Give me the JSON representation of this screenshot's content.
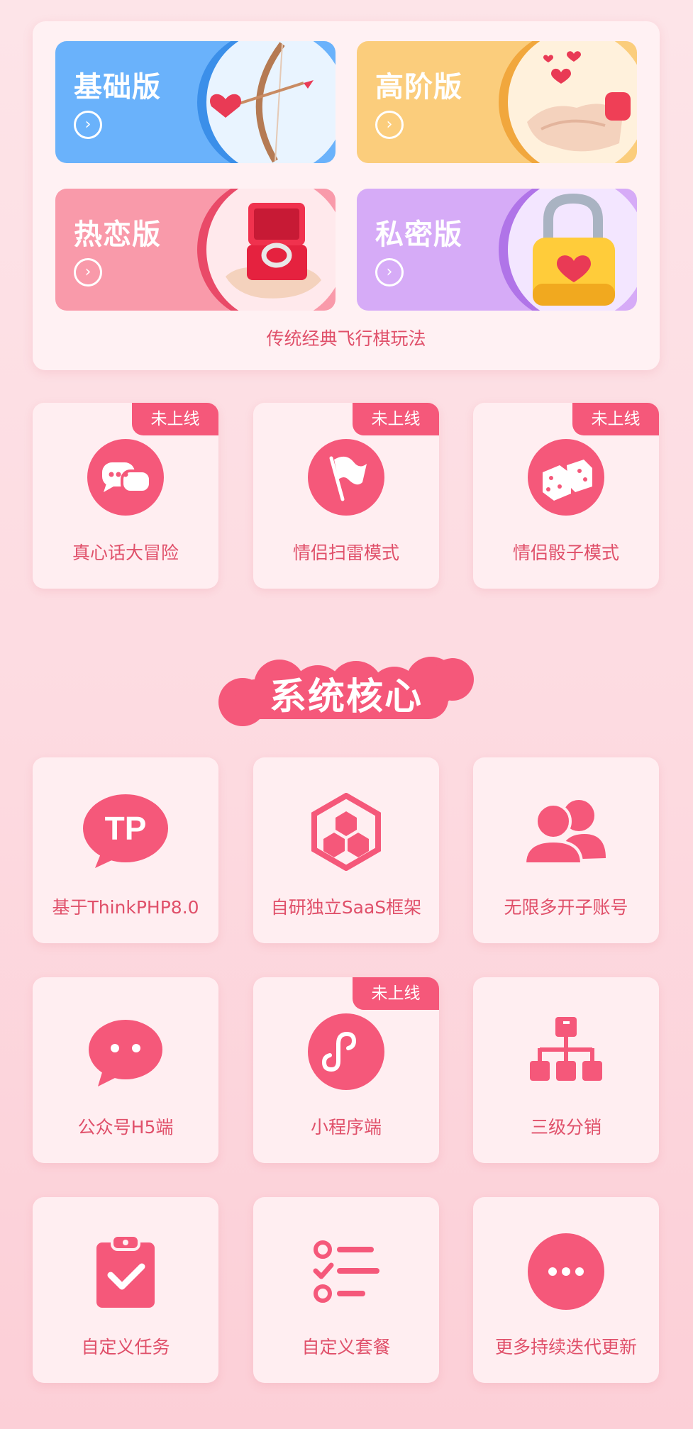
{
  "modes": [
    {
      "title": "基础版",
      "bg": "#6ab2fb",
      "accent": "#3b8fe9",
      "circle": "#e9f4ff",
      "art": "bow-arrow-heart"
    },
    {
      "title": "高阶版",
      "bg": "#fbcd7c",
      "accent": "#f1a73d",
      "circle": "#fff1dc",
      "art": "holding-hands-heart"
    },
    {
      "title": "热恋版",
      "bg": "#f99aaa",
      "accent": "#e94a68",
      "circle": "#ffe9ec",
      "art": "ring-box-on-hand"
    },
    {
      "title": "私密版",
      "bg": "#d6abf7",
      "accent": "#b074e8",
      "circle": "#f3e6ff",
      "art": "padlock-heart"
    }
  ],
  "panel_subtitle": "传统经典飞行棋玩法",
  "games": [
    {
      "label": "真心话大冒险",
      "badge": "未上线",
      "icon": "chat-bubbles-icon"
    },
    {
      "label": "情侣扫雷模式",
      "badge": "未上线",
      "icon": "flag-icon"
    },
    {
      "label": "情侣骰子模式",
      "badge": "未上线",
      "icon": "dice-icon"
    }
  ],
  "section_title": "系统核心",
  "features": [
    {
      "label": "基于ThinkPHP8.0",
      "icon": "tp-bubble-icon",
      "tp_text": "TP"
    },
    {
      "label": "自研独立SaaS框架",
      "icon": "hexagon-cluster-icon"
    },
    {
      "label": "无限多开子账号",
      "icon": "users-icon"
    },
    {
      "label": "公众号H5端",
      "icon": "wechat-bubble-icon"
    },
    {
      "label": "小程序端",
      "icon": "miniprogram-icon",
      "badge": "未上线"
    },
    {
      "label": "三级分销",
      "icon": "org-tree-icon"
    },
    {
      "label": "自定义任务",
      "icon": "clipboard-check-icon"
    },
    {
      "label": "自定义套餐",
      "icon": "checklist-icon"
    },
    {
      "label": "更多持续迭代更新",
      "icon": "more-dots-icon"
    }
  ],
  "colors": {
    "primary": "#f5587a",
    "text": "#e0506a",
    "card": "#ffeef1"
  }
}
